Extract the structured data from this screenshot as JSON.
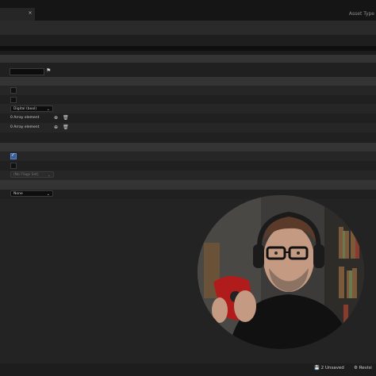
{
  "tabs": {
    "close_glyph": "×"
  },
  "header": {
    "asset_type_label": "Asset Type"
  },
  "properties": {
    "flag_icon": "flag",
    "digital_dropdown": "Digital (bool)",
    "array_1": "0 Array element",
    "array_2": "0 Array element",
    "flags_dropdown": "(No Flags Set)",
    "none_dropdown": "None",
    "checkbox_1_checked": false,
    "checkbox_2_checked": false,
    "checkbox_3_checked": true,
    "checkbox_4_checked": false
  },
  "status_bar": {
    "unsaved": "2 Unsaved",
    "revision": "Revisi"
  },
  "colors": {
    "accent": "#3a5e9a",
    "background": "#232323"
  }
}
